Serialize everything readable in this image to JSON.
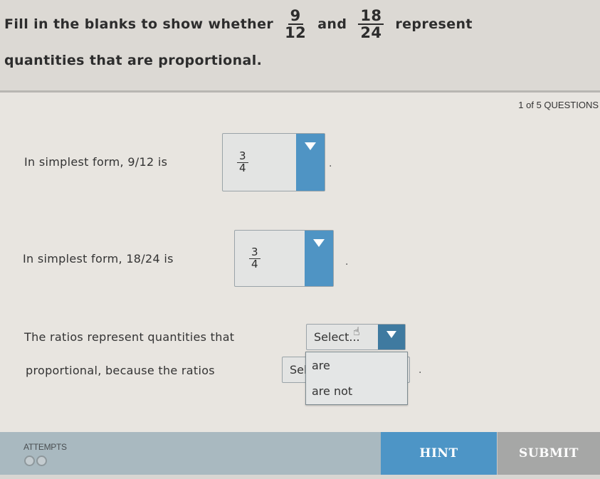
{
  "header": {
    "prefix": "Fill in the blanks to show whether",
    "fraction1": {
      "numerator": "9",
      "denominator": "12"
    },
    "conjunction": "and",
    "fraction2": {
      "numerator": "18",
      "denominator": "24"
    },
    "suffix": "represent",
    "line2": "quantities that are proportional."
  },
  "question_counter": "1 of 5 QUESTIONS",
  "rows": [
    {
      "label": "In simplest form, 9/12 is",
      "selected": {
        "numerator": "3",
        "denominator": "4"
      },
      "trailing": "."
    },
    {
      "label": "In simplest form, 18/24 is",
      "selected": {
        "numerator": "3",
        "denominator": "4"
      },
      "trailing": "."
    }
  ],
  "sentence": {
    "part1": "The ratios represent quantities that",
    "dropdown1_value": "Select...",
    "part2": "proportional, because the ratios",
    "dropdown2_value": "Sel",
    "trailing": ".",
    "open_menu_options": [
      "are",
      "are not"
    ]
  },
  "footer": {
    "attempts_label": "ATTEMPTS",
    "attempts_remaining": 2,
    "hint_label": "HINT",
    "submit_label": "SUBMIT",
    "colors": {
      "hint": "#4d95c6",
      "submit": "#a6a7a6",
      "bar": "#a9b9c0"
    }
  }
}
